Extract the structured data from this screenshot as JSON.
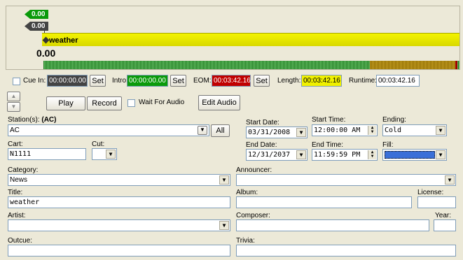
{
  "waveform": {
    "tag_top": "0.00",
    "tag_bottom": "0.00",
    "cut_name": "weather",
    "position": "0.00"
  },
  "cue": {
    "label": "Cue In:",
    "value": "00:00:00.00",
    "set": "Set"
  },
  "intro": {
    "label": "Intro:",
    "value": "00:00:00.00",
    "set": "Set"
  },
  "eom": {
    "label": "EOM:",
    "value": "00:03:42.16",
    "set": "Set"
  },
  "length": {
    "label": "Length:",
    "value": "00:03:42.16"
  },
  "runtime": {
    "label": "Runtime:",
    "value": "00:03:42.16"
  },
  "controls": {
    "play": "Play",
    "record": "Record",
    "wait": "Wait For Audio",
    "edit": "Edit Audio"
  },
  "stations": {
    "label": "Station(s):",
    "selected": "(AC)",
    "value": "AC",
    "all": "All"
  },
  "cart": {
    "label": "Cart:",
    "value": "N1111"
  },
  "cut": {
    "label": "Cut:",
    "value": ""
  },
  "start_date": {
    "label": "Start Date:",
    "value": "03/31/2008"
  },
  "start_time": {
    "label": "Start Time:",
    "value": "12:00:00 AM"
  },
  "ending": {
    "label": "Ending:",
    "value": "Cold"
  },
  "end_date": {
    "label": "End Date:",
    "value": "12/31/2037"
  },
  "end_time": {
    "label": "End Time:",
    "value": "11:59:59 PM"
  },
  "fill": {
    "label": "Fill:",
    "value": ""
  },
  "category": {
    "label": "Category:",
    "value": "News"
  },
  "announcer": {
    "label": "Announcer:",
    "value": ""
  },
  "title": {
    "label": "Title:",
    "value": "weather"
  },
  "album": {
    "label": "Album:",
    "value": ""
  },
  "license": {
    "label": "License:",
    "value": ""
  },
  "artist": {
    "label": "Artist:",
    "value": ""
  },
  "composer": {
    "label": "Composer:",
    "value": ""
  },
  "year": {
    "label": "Year:",
    "value": ""
  },
  "outcue": {
    "label": "Outcue:",
    "value": ""
  },
  "trivia": {
    "label": "Trivia:",
    "value": ""
  },
  "colors": {
    "green": "#0a9a0a",
    "red": "#c00000",
    "yellow": "#f0f000",
    "fill_blue": "#3a6fd8"
  }
}
